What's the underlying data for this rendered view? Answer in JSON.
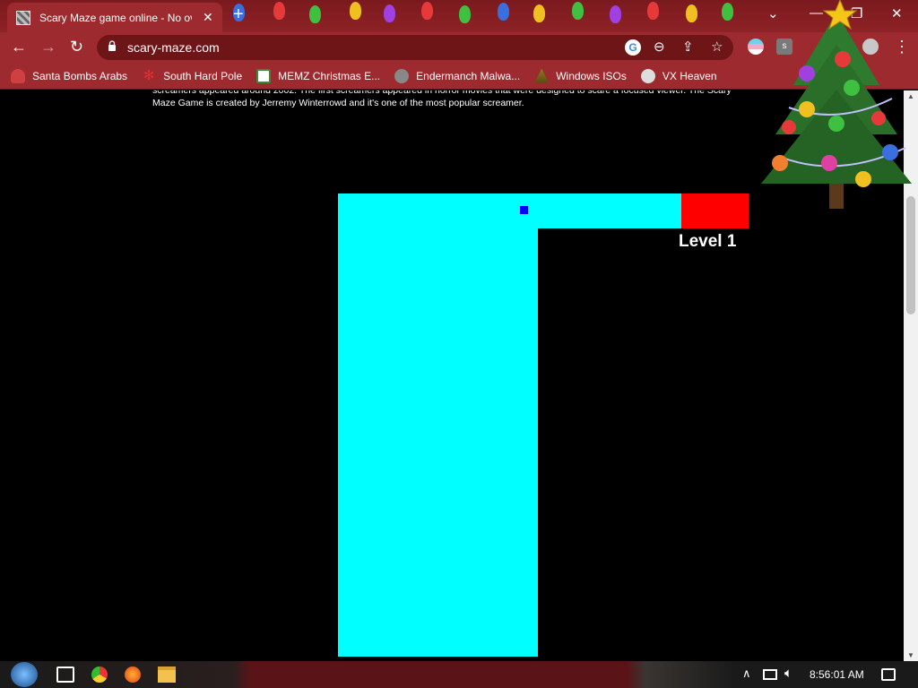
{
  "browser": {
    "tab_title": "Scary Maze game online - No ov",
    "tab_close": "✕",
    "new_tab": "+",
    "window_controls": {
      "dropdown": "⌄",
      "minimize": "—",
      "restore": "❐",
      "close": "✕"
    },
    "url": "scary-maze.com",
    "nav": {
      "back": "←",
      "forward": "→",
      "reload": "↻"
    },
    "omnibox_icons": {
      "google": "G",
      "zoom": "⊖",
      "share": "⇪",
      "star": "☆"
    },
    "menu": "⋮"
  },
  "bookmarks": [
    {
      "label": "Santa Bombs Arabs",
      "icon": "santa-icon",
      "color": "#d04040"
    },
    {
      "label": "South Hard Pole",
      "icon": "snowflake-icon",
      "color": "#e03030"
    },
    {
      "label": "MEMZ Christmas E...",
      "icon": "memz-icon",
      "color": "#ffffff"
    },
    {
      "label": "Endermanch Malwa...",
      "icon": "raccoon-icon",
      "color": "#888888"
    },
    {
      "label": "Windows ISOs",
      "icon": "tree-icon",
      "color": "#8a7a20"
    },
    {
      "label": "VX Heaven",
      "icon": "vx-icon",
      "color": "#dddddd"
    }
  ],
  "page": {
    "intro_text": "screamers appeared around 2002. The first screamers appeared in horror movies that were designed to scare a focused viewer. The Scary Maze Game is created by Jerremy Winterrowd and it's one of the most popular screamer.",
    "level_label": "Level 1",
    "colors": {
      "maze": "#00ffff",
      "goal": "#ff0000",
      "player": "#0000ff",
      "background": "#000000"
    }
  },
  "taskbar": {
    "clock": "8:56:01 AM",
    "tray_icons": [
      "chevron-up-icon",
      "network-icon",
      "volume-icon",
      "notification-icon"
    ],
    "pinned": [
      "start-icon",
      "task-view-icon",
      "chrome-icon",
      "firefox-icon",
      "explorer-icon"
    ]
  }
}
